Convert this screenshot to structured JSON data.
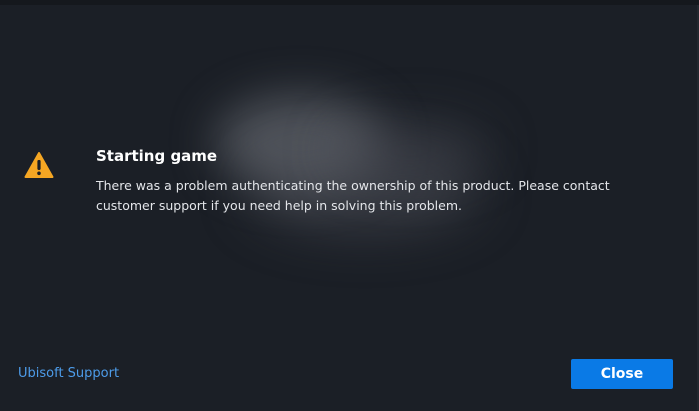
{
  "dialog": {
    "title": "Starting game",
    "message": "There was a problem authenticating the ownership of this product. Please contact customer support if you need help in solving this problem.",
    "icon": "warning-icon",
    "icon_color": "#f5a623"
  },
  "footer": {
    "support_link_label": "Ubisoft Support",
    "close_label": "Close"
  },
  "colors": {
    "background": "#1b1f26",
    "accent": "#0a7ae6",
    "link": "#4d9cea"
  }
}
